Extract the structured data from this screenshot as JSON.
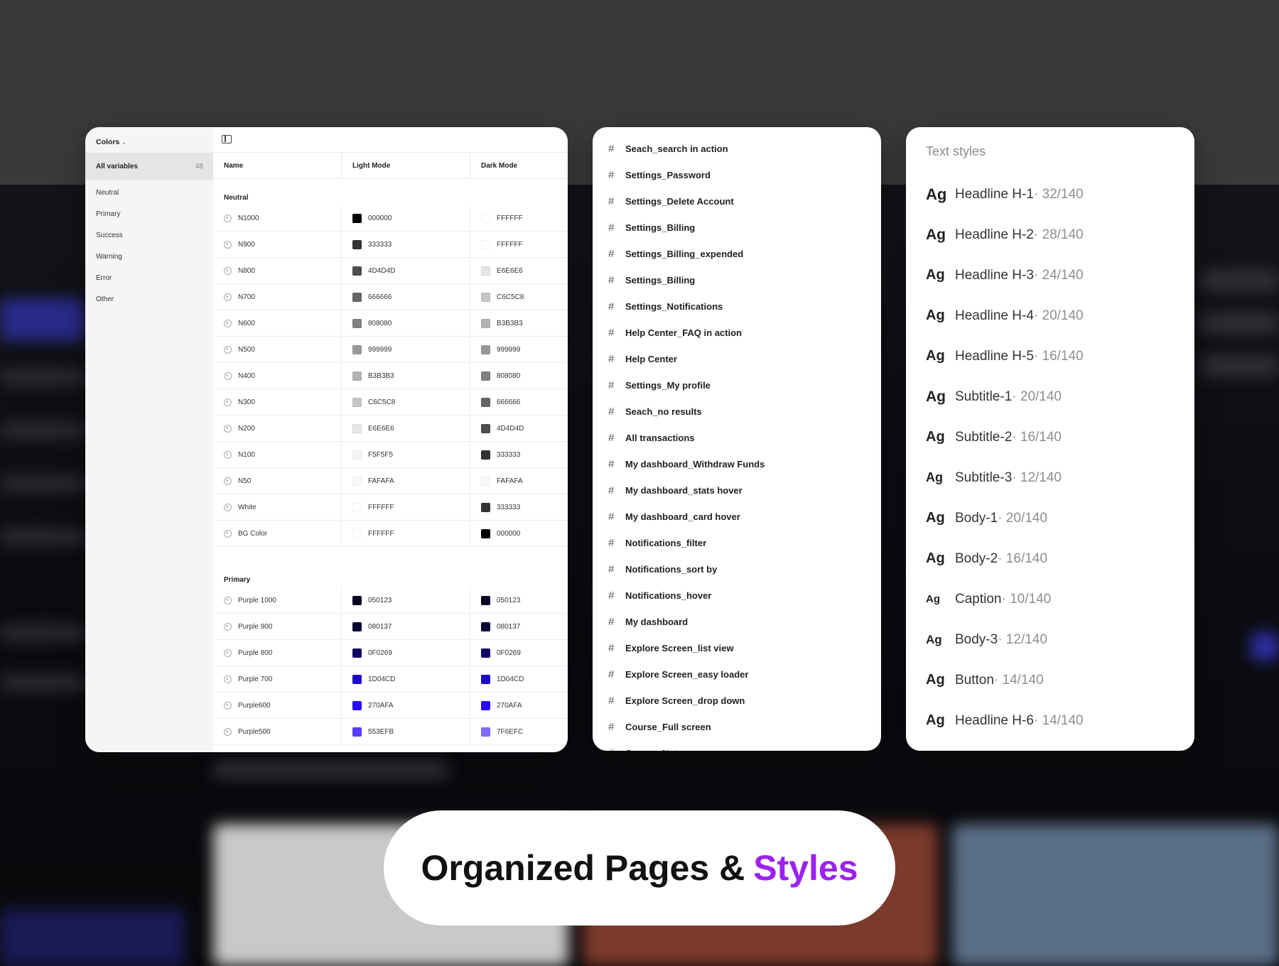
{
  "variables_panel": {
    "collection": "Colors",
    "all_variables": {
      "label": "All variables",
      "count": "48"
    },
    "groups": [
      "Neutral",
      "Primary",
      "Success",
      "Warning",
      "Error",
      "Other"
    ],
    "columns": {
      "name": "Name",
      "light": "Light Mode",
      "dark": "Dark Mode"
    },
    "sections": [
      {
        "title": "Neutral",
        "rows": [
          {
            "name": "N1000",
            "light": "000000",
            "dark": "FFFFFF",
            "light_color": "#000000",
            "dark_color": "#FFFFFF"
          },
          {
            "name": "N900",
            "light": "333333",
            "dark": "FFFFFF",
            "light_color": "#333333",
            "dark_color": "#FFFFFF"
          },
          {
            "name": "N800",
            "light": "4D4D4D",
            "dark": "E6E6E6",
            "light_color": "#4D4D4D",
            "dark_color": "#E6E6E6"
          },
          {
            "name": "N700",
            "light": "666666",
            "dark": "C6C5C8",
            "light_color": "#666666",
            "dark_color": "#C6C5C8"
          },
          {
            "name": "N600",
            "light": "808080",
            "dark": "B3B3B3",
            "light_color": "#808080",
            "dark_color": "#B3B3B3"
          },
          {
            "name": "N500",
            "light": "999999",
            "dark": "999999",
            "light_color": "#999999",
            "dark_color": "#999999"
          },
          {
            "name": "N400",
            "light": "B3B3B3",
            "dark": "808080",
            "light_color": "#B3B3B3",
            "dark_color": "#808080"
          },
          {
            "name": "N300",
            "light": "C6C5C8",
            "dark": "666666",
            "light_color": "#C6C5C8",
            "dark_color": "#666666"
          },
          {
            "name": "N200",
            "light": "E6E6E6",
            "dark": "4D4D4D",
            "light_color": "#E6E6E6",
            "dark_color": "#4D4D4D"
          },
          {
            "name": "N100",
            "light": "F5F5F5",
            "dark": "333333",
            "light_color": "#F5F5F5",
            "dark_color": "#333333"
          },
          {
            "name": "N50",
            "light": "FAFAFA",
            "dark": "FAFAFA",
            "light_color": "#FAFAFA",
            "dark_color": "#FAFAFA"
          },
          {
            "name": "White",
            "light": "FFFFFF",
            "dark": "333333",
            "light_color": "#FFFFFF",
            "dark_color": "#333333"
          },
          {
            "name": "BG Color",
            "light": "FFFFFF",
            "dark": "000000",
            "light_color": "#FFFFFF",
            "dark_color": "#000000"
          }
        ]
      },
      {
        "title": "Primary",
        "rows": [
          {
            "name": "Purple 1000",
            "light": "050123",
            "dark": "050123",
            "light_color": "#050123",
            "dark_color": "#050123"
          },
          {
            "name": "Purple 900",
            "light": "080137",
            "dark": "080137",
            "light_color": "#080137",
            "dark_color": "#080137"
          },
          {
            "name": "Purple 800",
            "light": "0F0269",
            "dark": "0F0269",
            "light_color": "#0F0269",
            "dark_color": "#0F0269"
          },
          {
            "name": "Purple 700",
            "light": "1D04CD",
            "dark": "1D04CD",
            "light_color": "#1D04CD",
            "dark_color": "#1D04CD"
          },
          {
            "name": "Purple600",
            "light": "270AFA",
            "dark": "270AFA",
            "light_color": "#270AFA",
            "dark_color": "#270AFA"
          },
          {
            "name": "Purple500",
            "light": "553EFB",
            "dark": "7F6EFC",
            "light_color": "#553EFB",
            "dark_color": "#7F6EFC"
          }
        ]
      }
    ]
  },
  "pages_panel": {
    "pages": [
      "Seach_search in action",
      "Settings_Password",
      "Settings_Delete Account",
      "Settings_Billing",
      "Settings_Billing_expended",
      "Settings_Billing",
      "Settings_Notifications",
      "Help Center_FAQ in action",
      "Help Center",
      "Settings_My profile",
      "Seach_no results",
      "All transactions",
      "My dashboard_Withdraw Funds",
      "My dashboard_stats hover",
      "My dashboard_card hover",
      "Notifications_filter",
      "Notifications_sort by",
      "Notifications_hover",
      "My dashboard",
      "Explore Screen_list view",
      "Explore Screen_easy loader",
      "Explore Screen_drop down",
      "Course_Full screen",
      "Course_Notes"
    ]
  },
  "text_styles_panel": {
    "title": "Text styles",
    "sample": "Ag",
    "styles": [
      {
        "name": "Headline H-1",
        "spec": " · 32/140",
        "sample_size": 22
      },
      {
        "name": "Headline H-2",
        "spec": " · 28/140",
        "sample_size": 21
      },
      {
        "name": "Headline H-3",
        "spec": " · 24/140",
        "sample_size": 20
      },
      {
        "name": "Headline H-4",
        "spec": " · 20/140",
        "sample_size": 20
      },
      {
        "name": "Headline H-5",
        "spec": " · 16/140",
        "sample_size": 20
      },
      {
        "name": "Subtitle-1",
        "spec": " · 20/140",
        "sample_size": 21
      },
      {
        "name": "Subtitle-2",
        "spec": " · 16/140",
        "sample_size": 20
      },
      {
        "name": "Subtitle-3",
        "spec": " · 12/140",
        "sample_size": 18
      },
      {
        "name": "Body-1",
        "spec": " · 20/140",
        "sample_size": 20
      },
      {
        "name": "Body-2",
        "spec": " · 16/140",
        "sample_size": 20
      },
      {
        "name": "Caption",
        "spec": " · 10/140",
        "sample_size": 15
      },
      {
        "name": "Body-3",
        "spec": " · 12/140",
        "sample_size": 17
      },
      {
        "name": "Button",
        "spec": " · 14/140",
        "sample_size": 20
      },
      {
        "name": "Headline H-6",
        "spec": " · 14/140",
        "sample_size": 20
      }
    ]
  },
  "banner": {
    "text": "Organized Pages &",
    "accent": "Styles",
    "accent_color": "#9B22F0"
  }
}
